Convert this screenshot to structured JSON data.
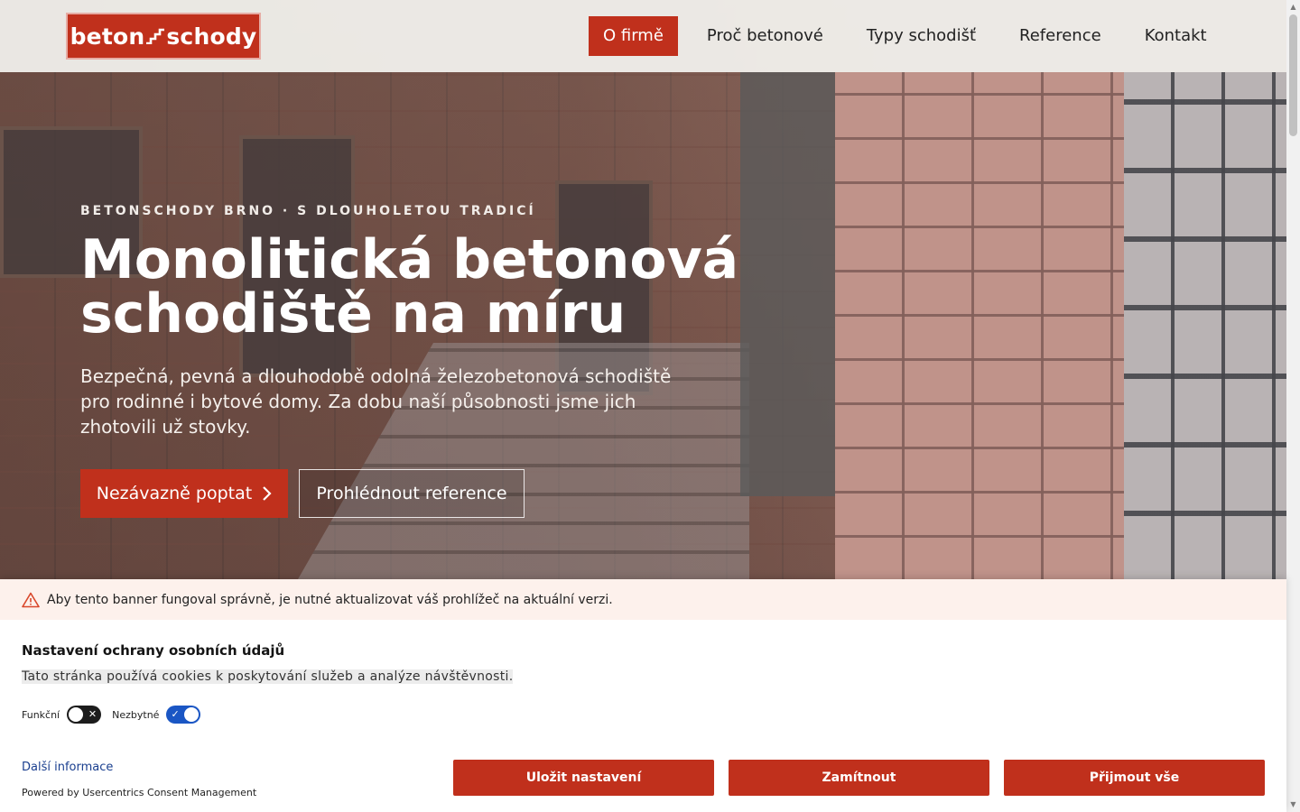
{
  "brand": {
    "logo_left": "beton",
    "logo_right": "schody",
    "accent": "#c0301c"
  },
  "nav": {
    "items": [
      {
        "label": "O firmě",
        "active": true
      },
      {
        "label": "Proč betonové",
        "active": false
      },
      {
        "label": "Typy schodišť",
        "active": false
      },
      {
        "label": "Reference",
        "active": false
      },
      {
        "label": "Kontakt",
        "active": false
      }
    ]
  },
  "hero": {
    "eyebrow": "BETONSCHODY BRNO · S DLOUHOLETOU TRADICÍ",
    "headline_line1": "Monolitická betonová",
    "headline_line2": "schodiště na míru",
    "lead": "Bezpečná, pevná a dlouhodobě odolná železobetonová schodiště pro rodinné i bytové domy. Za dobu naší působnosti jsme jich zhotovili už stovky.",
    "cta_primary": "Nezávazně poptat",
    "cta_secondary": "Prohlédnout reference"
  },
  "consent": {
    "warning": "Aby tento banner fungoval správně, je nutné aktualizovat váš prohlížeč na aktuální verzi.",
    "title": "Nastavení ochrany osobních údajů",
    "description": "Tato stránka používá cookies k poskytování služeb a analýze návštěvnosti.",
    "toggles": [
      {
        "label": "Funkční",
        "state": "off"
      },
      {
        "label": "Nezbytné",
        "state": "on"
      }
    ],
    "more_info": "Další informace",
    "powered_by": "Powered by Usercentrics Consent Management",
    "buttons": {
      "save": "Uložit nastavení",
      "deny": "Zamítnout",
      "accept": "Přijmout vše"
    }
  },
  "icons": {
    "logo_mark": "stair-icon",
    "cta_arrow": "chevron-right-icon",
    "warning": "warning-triangle-icon",
    "toggle_off": "x-icon",
    "toggle_on": "check-icon"
  }
}
